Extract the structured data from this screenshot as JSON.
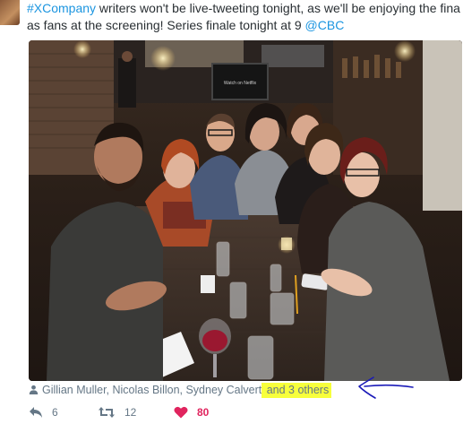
{
  "tweet": {
    "text_line1_hashtag": "#XCompany",
    "text_line1_rest": " writers won't be live-tweeting tonight, as we'll be enjoying the fina",
    "text_line2_prefix": "as fans at the screening! Series finale tonight at 9 ",
    "text_line2_mention": "@CBC"
  },
  "media": {
    "tv_screen_text": "Watch on Netflix"
  },
  "tagged": {
    "names": "Gillian Muller, Nicolas Billon, Sydney Calvert",
    "others": " and 3 others"
  },
  "actions": {
    "reply_count": "6",
    "retweet_count": "12",
    "like_count": "80"
  },
  "colors": {
    "link": "#1b95e0",
    "highlight": "#f7ff3c",
    "like": "#e0245e",
    "annotation_arrow": "#1a1ab8"
  },
  "icons": {
    "tag": "person-icon",
    "reply": "reply-icon",
    "retweet": "retweet-icon",
    "like": "heart-icon",
    "annotation": "hand-drawn-arrow-icon"
  }
}
